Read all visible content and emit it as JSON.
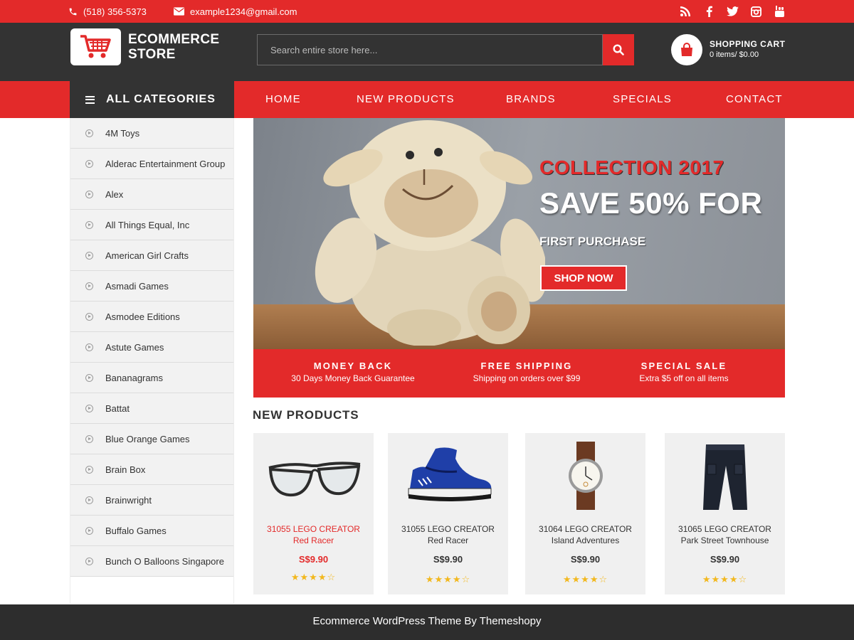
{
  "topbar": {
    "phone": "(518) 356-5373",
    "email": "example1234@gmail.com",
    "social": [
      "rss-icon",
      "facebook-icon",
      "twitter-icon",
      "instagram-icon",
      "youtube-icon"
    ]
  },
  "header": {
    "logo_line1": "ECOMMERCE",
    "logo_line2": "STORE",
    "search_placeholder": "Search entire store here...",
    "cart_title": "SHOPPING CART",
    "cart_summary": "0 items/ $0.00"
  },
  "nav": {
    "all_categories": "ALL CATEGORIES",
    "links": [
      "HOME",
      "NEW PRODUCTS",
      "BRANDS",
      "SPECIALS",
      "CONTACT"
    ]
  },
  "categories": [
    "4M Toys",
    "Alderac Entertainment Group",
    "Alex",
    "All Things Equal, Inc",
    "American Girl Crafts",
    "Asmadi Games",
    "Asmodee Editions",
    "Astute Games",
    "Bananagrams",
    "Battat",
    "Blue Orange Games",
    "Brain Box",
    "Brainwright",
    "Buffalo Games",
    "Bunch O Balloons Singapore"
  ],
  "banner": {
    "collection": "COLLECTION 2017",
    "save": "SAVE 50% FOR",
    "first_purchase": "FIRST PURCHASE",
    "button": "SHOP NOW"
  },
  "features": [
    {
      "title": "MONEY BACK",
      "subtitle": "30 Days Money Back Guarantee"
    },
    {
      "title": "FREE SHIPPING",
      "subtitle": "Shipping on orders over $99"
    },
    {
      "title": "SPECIAL SALE",
      "subtitle": "Extra $5 off on all items"
    }
  ],
  "products_section_title": "NEW PRODUCTS",
  "products": [
    {
      "line1": "31055 LEGO CREATOR",
      "line2": "Red Racer",
      "price": "S$9.90",
      "rating": 4,
      "stars": "★★★★☆",
      "image": "glasses-image"
    },
    {
      "line1": "31055 LEGO CREATOR",
      "line2": "Red Racer",
      "price": "S$9.90",
      "rating": 4,
      "stars": "★★★★☆",
      "image": "sneaker-image"
    },
    {
      "line1": "31064 LEGO CREATOR",
      "line2": "Island Adventures",
      "price": "S$9.90",
      "rating": 4,
      "stars": "★★★★☆",
      "image": "watch-image"
    },
    {
      "line1": "31065 LEGO CREATOR",
      "line2": "Park Street Townhouse",
      "price": "S$9.90",
      "rating": 4,
      "stars": "★★★★☆",
      "image": "trousers-image"
    }
  ],
  "footer": {
    "text": "Ecommerce WordPress Theme By Themeshopy"
  },
  "colors": {
    "accent": "#e32a2a",
    "dark": "#333333",
    "card_bg": "#f0f0f0",
    "star": "#f2b81e"
  }
}
